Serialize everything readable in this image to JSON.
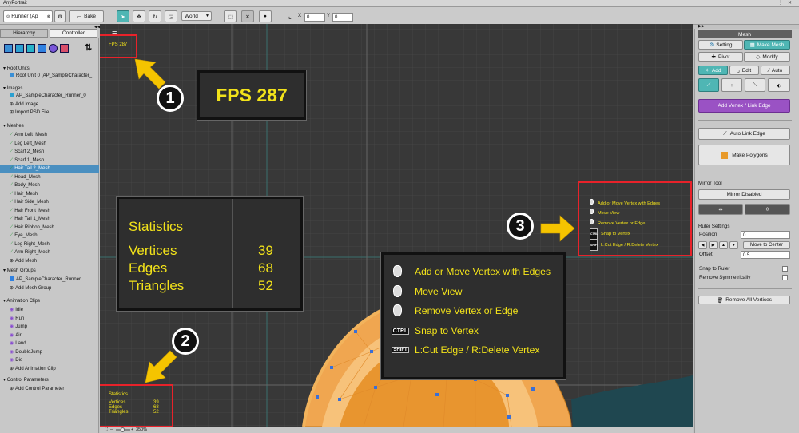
{
  "window": {
    "title": "AnyPortrait"
  },
  "toolbar": {
    "model_select": "Runner (Ap",
    "bake_label": "Bake",
    "space_select": "World",
    "x_label": "X",
    "x_value": "0",
    "y_label": "Y",
    "y_value": "0"
  },
  "left_tabs": {
    "hierarchy": "Hierarchy",
    "controller": "Controller"
  },
  "hierarchy": {
    "root_units": {
      "title": "Root Units",
      "items": [
        "Root Unit 0 (AP_SampleCharacter_"
      ]
    },
    "images": {
      "title": "Images",
      "items": [
        "AP_SampleCharacter_Runner_0",
        "Add Image",
        "Import PSD File"
      ]
    },
    "meshes": {
      "title": "Meshes",
      "items": [
        "Arm Left_Mesh",
        "Leg Left_Mesh",
        "Scarf 2_Mesh",
        "Scarf 1_Mesh",
        "Hair Tail 2_Mesh",
        "Head_Mesh",
        "Body_Mesh",
        "Hair_Mesh",
        "Hair Side_Mesh",
        "Hair Front_Mesh",
        "Hair Tail 1_Mesh",
        "Hair Ribbon_Mesh",
        "Eye_Mesh",
        "Leg Right_Mesh",
        "Arm Right_Mesh",
        "Add Mesh"
      ],
      "selected_index": 4
    },
    "mesh_groups": {
      "title": "Mesh Groups",
      "items": [
        "AP_SampleCharacter_Runner",
        "Add Mesh Group"
      ]
    },
    "animation_clips": {
      "title": "Animation Clips",
      "items": [
        "Idle",
        "Run",
        "Jump",
        "Air",
        "Land",
        "DoubleJump",
        "Die",
        "Add Animation Clip"
      ]
    },
    "control_parameters": {
      "title": "Control Parameters",
      "items": [
        "Add Control Parameter"
      ]
    }
  },
  "viewport": {
    "fps_small": "FPS 287",
    "stats_small": {
      "title": "Statistics",
      "rows": [
        {
          "label": "Vertices",
          "value": "39"
        },
        {
          "label": "Edges",
          "value": "68"
        },
        {
          "label": "Triangles",
          "value": "52"
        }
      ]
    },
    "hints_small": [
      "Add or Move Vertex with Edges",
      "Move View",
      "Remove Vertex or Edge",
      "Snap to Vertex",
      "L:Cut Edge / R:Delete Vertex"
    ],
    "zoom": "350%"
  },
  "callouts": {
    "fps_big": "FPS 287",
    "stats_big": {
      "title": "Statistics",
      "rows": [
        {
          "label": "Vertices",
          "value": "39"
        },
        {
          "label": "Edges",
          "value": "68"
        },
        {
          "label": "Triangles",
          "value": "52"
        }
      ]
    },
    "hints_big": [
      "Add or Move Vertex with Edges",
      "Move View",
      "Remove Vertex or Edge",
      "Snap to Vertex",
      "L:Cut Edge / R:Delete Vertex"
    ],
    "key_ctrl": "CTRL",
    "key_shift": "SHIFT",
    "numbers": [
      "1",
      "2",
      "3"
    ]
  },
  "right_panel": {
    "title": "Mesh",
    "setting": "Setting",
    "make_mesh": "Make Mesh",
    "pivot": "Pivot",
    "modify": "Modify",
    "add": "Add",
    "edit": "Edit",
    "auto": "Auto",
    "add_vertex": "Add Vertex / Link Edge",
    "auto_link": "Auto Link Edge",
    "make_polygons": "Make Polygons",
    "mirror_tool": "Mirror Tool",
    "mirror_disabled": "Mirror Disabled",
    "ruler_settings": "Ruler Settings",
    "position": "Position",
    "position_value": "0",
    "move_to_center": "Move to Center",
    "offset": "Offset",
    "offset_value": "0.5",
    "snap_to_ruler": "Snap to Ruler",
    "remove_symmetrically": "Remove Symmetrically",
    "remove_all_vertices": "Remove All Vertices"
  },
  "colors": {
    "accent_teal": "#4fb6b4",
    "purple": "#9a52c4",
    "callout_yellow": "#f2e21a",
    "red_box": "#e8222a",
    "arrow_yellow": "#f5c400"
  }
}
